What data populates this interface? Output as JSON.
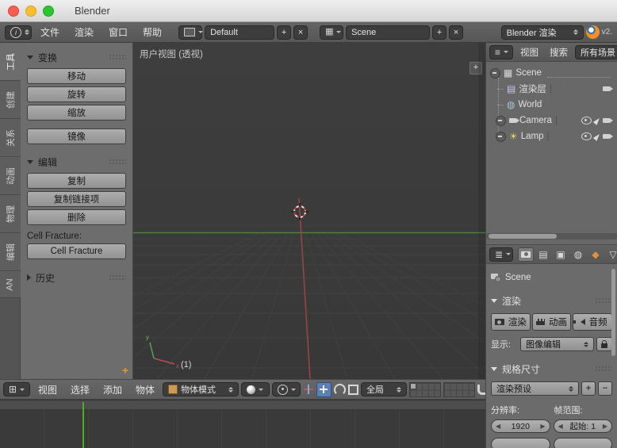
{
  "window": {
    "title": "Blender"
  },
  "glyphs": {
    "plus": "+",
    "close": "×",
    "minus": "−",
    "left": "◀",
    "right": "▶",
    "pipe": "|"
  },
  "menubar": {
    "menus": [
      "文件",
      "渲染",
      "窗口",
      "帮助"
    ],
    "layout_value": "Default",
    "scene_value": "Scene",
    "engine_value": "Blender 渲染",
    "version": "v2."
  },
  "tool_tabs": [
    "工具",
    "创建",
    "关系",
    "动画",
    "物理",
    "编辑",
    "AN"
  ],
  "tool_shelf": {
    "transform": {
      "title": "变换",
      "buttons": [
        "移动",
        "旋转",
        "缩放",
        "镜像"
      ]
    },
    "edit": {
      "title": "编辑",
      "buttons": [
        "复制",
        "复制链接项",
        "删除"
      ]
    },
    "cell_fracture": {
      "label": "Cell Fracture:",
      "button": "Cell Fracture"
    },
    "history": {
      "title": "历史"
    }
  },
  "viewport": {
    "view_label": "用户视图 (透视)",
    "layer_note": "(1)",
    "axis_x": "x",
    "axis_y": "y"
  },
  "viewport_header": {
    "menus": [
      "视图",
      "选择",
      "添加",
      "物体"
    ],
    "mode": "物体模式",
    "orientation": "全局"
  },
  "outliner": {
    "menu_view": "视图",
    "menu_search": "搜索",
    "filter": "所有场景",
    "rows": [
      {
        "label": "Scene"
      },
      {
        "label": "渲染层"
      },
      {
        "label": "World"
      },
      {
        "label": "Camera"
      },
      {
        "label": "Lamp"
      }
    ]
  },
  "properties": {
    "context": "Scene",
    "render": {
      "title": "渲染",
      "render_btn": "渲染",
      "anim_btn": "动画",
      "audio_btn": "音频",
      "display_label": "显示:",
      "display_value": "图像编辑"
    },
    "dimensions": {
      "title": "规格尺寸",
      "preset": "渲染预设",
      "resolution_label": "分辨率:",
      "frame_label": "帧范围:",
      "res_x": "1920",
      "frame_start": "起始: 1"
    }
  },
  "colors": {
    "axis_green": "#4f8040",
    "axis_red": "#9a4646",
    "playhead_green": "#46b31e",
    "accent_orange": "#ef8f2e"
  }
}
